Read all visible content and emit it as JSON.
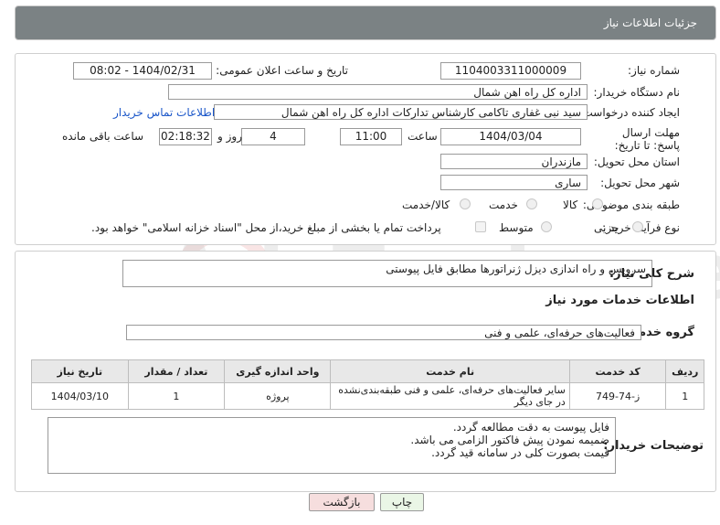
{
  "header": {
    "title": "جزئیات اطلاعات نیاز"
  },
  "form": {
    "need_number_label": "شماره نیاز:",
    "need_number": "1104003311000009",
    "announce_datetime_label": "تاریخ و ساعت اعلان عمومی:",
    "announce_datetime": "1404/02/31 - 08:02",
    "buyer_org_label": "نام دستگاه خریدار:",
    "buyer_org": "اداره کل راه اهن شمال",
    "creator_label": "ایجاد کننده درخواست:",
    "creator": "سید نبی غفاری تاکامی کارشناس تدارکات اداره کل راه اهن شمال",
    "contact_link": "اطلاعات تماس خریدار",
    "deadline_label": "مهلت ارسال پاسخ: تا تاریخ:",
    "deadline_date": "1404/03/04",
    "time_label": "ساعت",
    "deadline_time": "11:00",
    "days_value": "4",
    "days_label": "روز و",
    "remaining_time": "02:18:32",
    "remaining_label": "ساعت باقی مانده",
    "province_label": "استان محل تحویل:",
    "province": "مازندران",
    "city_label": "شهر محل تحویل:",
    "city": "ساری",
    "category_label": "طبقه بندی موضوعی:",
    "category_options": [
      "کالا",
      "خدمت",
      "کالا/خدمت"
    ],
    "purchase_type_label": "نوع فرآیند خرید :",
    "purchase_options": [
      "جزیی",
      "متوسط"
    ],
    "payment_note": "پرداخت تمام یا بخشی از مبلغ خرید،از محل \"اسناد خزانه اسلامی\" خواهد بود."
  },
  "summary": {
    "label": "شرح کلی نیاز:",
    "text": "سرویس و راه اندازی دیزل ژنراتورها مطابق فایل پیوستی"
  },
  "services": {
    "section_title": "اطلاعات خدمات مورد نیاز",
    "group_label": "گروه خدمت:",
    "group_value": "فعالیت‌های حرفه‌ای، علمی و فنی",
    "columns": [
      "ردیف",
      "کد خدمت",
      "نام خدمت",
      "واحد اندازه گیری",
      "تعداد / مقدار",
      "تاریخ نیاز"
    ],
    "rows": [
      [
        "1",
        "ز-74-749",
        "سایر فعالیت‌های حرفه‌ای، علمی و فنی طبقه‌بندی‌نشده در جای دیگر",
        "پروژه",
        "1",
        "1404/03/10"
      ]
    ]
  },
  "notes": {
    "label": "توضیحات خریدار:",
    "line1": "فایل پیوست به دقت مطالعه گردد.",
    "line2": "ضمیمه نمودن پیش فاکتور الزامی می باشد.",
    "line3": "قیمت بصورت کلی در سامانه قید گردد."
  },
  "buttons": {
    "print": "چاپ",
    "back": "بازگشت"
  },
  "watermark": {
    "text": "AriaTender.neT"
  },
  "colors": {
    "header_bg": "#7b8284",
    "link": "#1a56c9",
    "back_button_bg": "#f6dede",
    "print_button_bg": "#eaf6e6"
  }
}
